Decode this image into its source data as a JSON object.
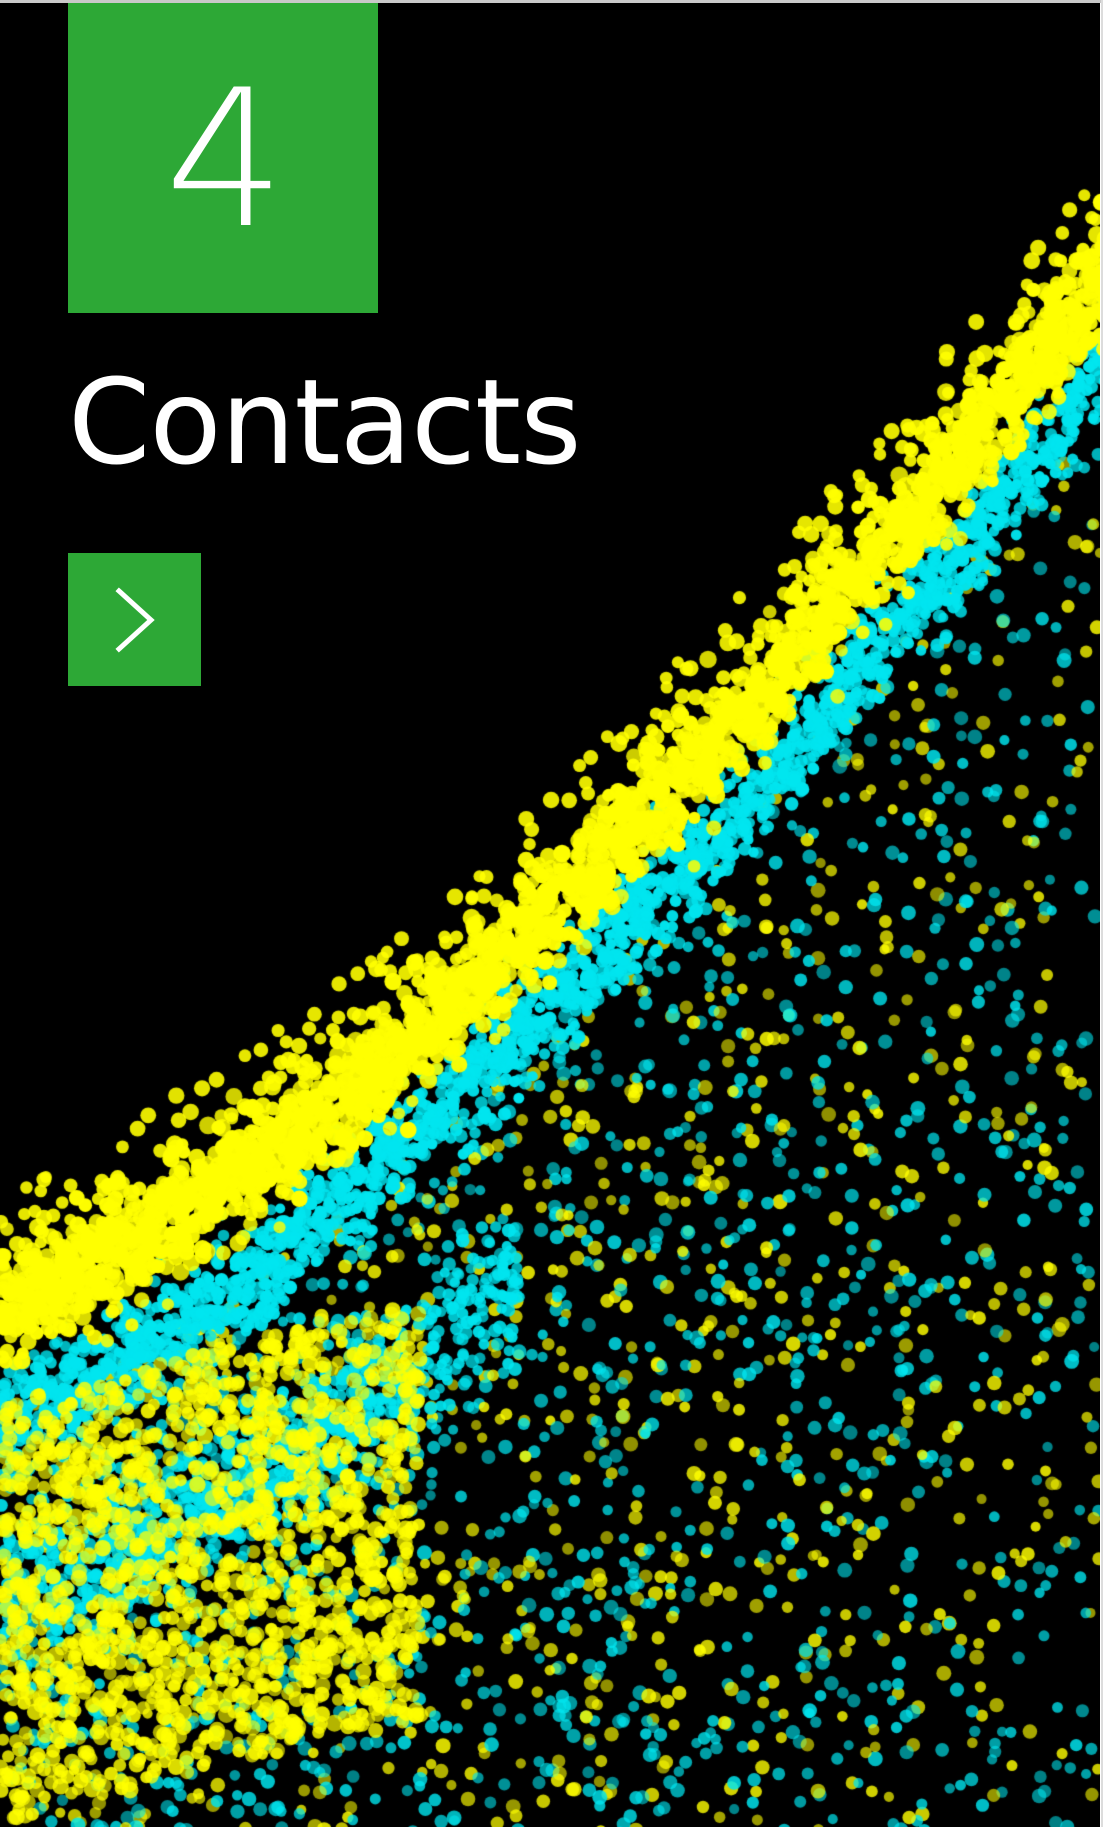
{
  "section": {
    "number": "4",
    "title": "Contacts"
  },
  "navigation": {
    "next_icon": "chevron-right-icon"
  },
  "colors": {
    "accent": "#2da836",
    "background": "#000000",
    "particle_yellow": "#ffff00",
    "particle_cyan": "#00e5ef",
    "text": "#ffffff"
  }
}
